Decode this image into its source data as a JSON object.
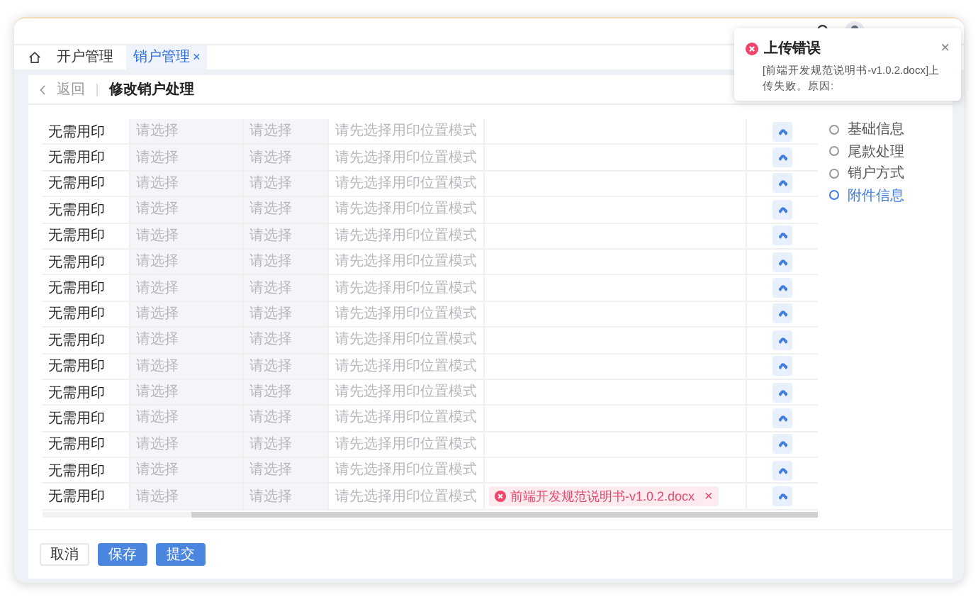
{
  "tabs": [
    {
      "label": "开户管理",
      "selected": false
    },
    {
      "label": "销户管理",
      "selected": true,
      "close": "×"
    }
  ],
  "page": {
    "back": "返回",
    "title": "修改销户处理"
  },
  "table": {
    "rows": [
      {
        "column_1": "无需用印",
        "column_2": {
          "placeholder": "请选择"
        },
        "column_3": {
          "placeholder": "请选择"
        },
        "column_4": {
          "placeholder": "请先选择用印位置模式"
        }
      },
      {
        "column_1": "无需用印",
        "column_2": {
          "placeholder": "请选择"
        },
        "column_3": {
          "placeholder": "请选择"
        },
        "column_4": {
          "placeholder": "请先选择用印位置模式"
        }
      },
      {
        "column_1": "无需用印",
        "column_2": {
          "placeholder": "请选择"
        },
        "column_3": {
          "placeholder": "请选择"
        },
        "column_4": {
          "placeholder": "请先选择用印位置模式"
        }
      },
      {
        "column_1": "无需用印",
        "column_2": {
          "placeholder": "请选择"
        },
        "column_3": {
          "placeholder": "请选择"
        },
        "column_4": {
          "placeholder": "请先选择用印位置模式"
        }
      },
      {
        "column_1": "无需用印",
        "column_2": {
          "placeholder": "请选择"
        },
        "column_3": {
          "placeholder": "请选择"
        },
        "column_4": {
          "placeholder": "请先选择用印位置模式"
        }
      },
      {
        "column_1": "无需用印",
        "column_2": {
          "placeholder": "请选择"
        },
        "column_3": {
          "placeholder": "请选择"
        },
        "column_4": {
          "placeholder": "请先选择用印位置模式"
        }
      },
      {
        "column_1": "无需用印",
        "column_2": {
          "placeholder": "请选择"
        },
        "column_3": {
          "placeholder": "请选择"
        },
        "column_4": {
          "placeholder": "请先选择用印位置模式"
        }
      },
      {
        "column_1": "无需用印",
        "column_2": {
          "placeholder": "请选择"
        },
        "column_3": {
          "placeholder": "请选择"
        },
        "column_4": {
          "placeholder": "请先选择用印位置模式"
        }
      },
      {
        "column_1": "无需用印",
        "column_2": {
          "placeholder": "请选择"
        },
        "column_3": {
          "placeholder": "请选择"
        },
        "column_4": {
          "placeholder": "请先选择用印位置模式"
        }
      },
      {
        "column_1": "无需用印",
        "column_2": {
          "placeholder": "请选择"
        },
        "column_3": {
          "placeholder": "请选择"
        },
        "column_4": {
          "placeholder": "请先选择用印位置模式"
        }
      },
      {
        "column_1": "无需用印",
        "column_2": {
          "placeholder": "请选择"
        },
        "column_3": {
          "placeholder": "请选择"
        },
        "column_4": {
          "placeholder": "请先选择用印位置模式"
        }
      },
      {
        "column_1": "无需用印",
        "column_2": {
          "placeholder": "请选择"
        },
        "column_3": {
          "placeholder": "请选择"
        },
        "column_4": {
          "placeholder": "请先选择用印位置模式"
        }
      },
      {
        "column_1": "无需用印",
        "column_2": {
          "placeholder": "请选择"
        },
        "column_3": {
          "placeholder": "请选择"
        },
        "column_4": {
          "placeholder": "请先选择用印位置模式"
        }
      },
      {
        "column_1": "无需用印",
        "column_2": {
          "placeholder": "请选择"
        },
        "column_3": {
          "placeholder": "请选择"
        },
        "column_4": {
          "placeholder": "请先选择用印位置模式"
        }
      },
      {
        "column_1": "无需用印",
        "column_2": {
          "placeholder": "请选择"
        },
        "column_3": {
          "placeholder": "请选择"
        },
        "column_4": {
          "placeholder": "请先选择用印位置模式"
        },
        "file": {
          "name": "前端开发规范说明书-v1.0.2.docx",
          "error": true,
          "remove": "×"
        }
      }
    ]
  },
  "anchors": [
    {
      "label": "基础信息",
      "selected": false
    },
    {
      "label": "尾款处理",
      "selected": false
    },
    {
      "label": "销户方式",
      "selected": false
    },
    {
      "label": "附件信息",
      "selected": true
    }
  ],
  "buttons": [
    {
      "label": "取消",
      "kind": "default"
    },
    {
      "label": "保存",
      "kind": "primary"
    },
    {
      "label": "提交",
      "kind": "primary"
    }
  ],
  "notification": {
    "error": true,
    "title": "上传错误",
    "message": "[前端开发规范说明书-v1.0.2.docx]上传失败。原因:",
    "close": "×"
  }
}
